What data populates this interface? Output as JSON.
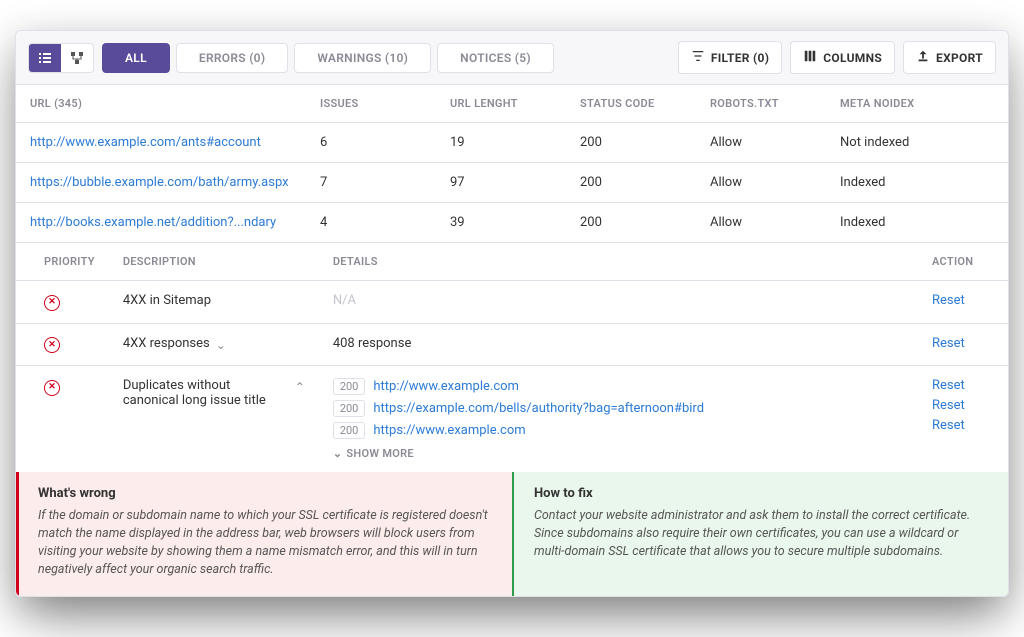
{
  "toolbar": {
    "tabs": [
      {
        "label": "ALL",
        "active": true
      },
      {
        "label": "ERRORS (0)",
        "active": false
      },
      {
        "label": "WARNINGS (10)",
        "active": false
      },
      {
        "label": "NOTICES (5)",
        "active": false
      }
    ],
    "filter_label": "FILTER (0)",
    "columns_label": "COLUMNS",
    "export_label": "EXPORT"
  },
  "url_table": {
    "headers": {
      "url": "URL (345)",
      "issues": "ISSUES",
      "url_length": "URL LENGHT",
      "status": "STATUS CODE",
      "robots": "ROBOTS.TXT",
      "meta_noidex": "META NOIDEX"
    },
    "rows": [
      {
        "url": "http://www.example.com/ants#account",
        "issues": "6",
        "len": "19",
        "status": "200",
        "robots": "Allow",
        "meta": "Not indexed"
      },
      {
        "url": "https://bubble.example.com/bath/army.aspx",
        "issues": "7",
        "len": "97",
        "status": "200",
        "robots": "Allow",
        "meta": "Indexed"
      },
      {
        "url": "http://books.example.net/addition?...ndary",
        "issues": "4",
        "len": "39",
        "status": "200",
        "robots": "Allow",
        "meta": "Indexed"
      }
    ]
  },
  "issue_table": {
    "headers": {
      "priority": "PRIORITY",
      "description": "DESCRIPTION",
      "details": "DETAILS",
      "action": "ACTION"
    },
    "reset_label": "Reset",
    "show_more_label": "SHOW MORE",
    "rows": [
      {
        "desc": "4XX in Sitemap",
        "detail_na": "N/A"
      },
      {
        "desc": "4XX responses",
        "expand": "down",
        "detail": "408 response"
      },
      {
        "desc": "Duplicates without canonical long issue title",
        "expand": "up",
        "details": [
          {
            "code": "200",
            "url": "http://www.example.com"
          },
          {
            "code": "200",
            "url": "https://example.com/bells/authority?bag=afternoon#bird"
          },
          {
            "code": "200",
            "url": "https://www.example.com"
          }
        ]
      }
    ]
  },
  "panels": {
    "wrong_title": "What's wrong",
    "wrong_body": "If the domain or subdomain name to which your SSL certificate is registered doesn't match the name displayed in the address bar, web browsers will block users from visiting your website by showing them a name mismatch error, and this will in turn negatively affect your organic search traffic.",
    "fix_title": "How to fix",
    "fix_body": "Contact your website administrator and ask them to install the correct certificate. Since subdomains also require their own certificates, you can use a wildcard or multi-domain SSL certificate that allows you to secure multiple subdomains."
  }
}
